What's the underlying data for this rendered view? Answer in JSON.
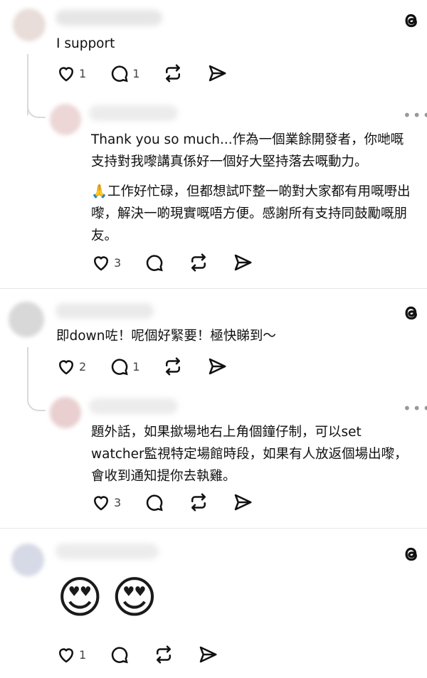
{
  "app": {
    "logo_icon": "threads-icon"
  },
  "comments": [
    {
      "text": "I support",
      "likes": "1",
      "replies": "1",
      "reply": {
        "paragraphs": [
          "Thank you so much...作為一個業餘開發者，你哋嘅支持對我嚟講真係好一個好大堅持落去嘅動力。",
          "🙏工作好忙碌，但都想試吓整一啲對大家都有用嘅嘢出嚟，解決一啲現實嘅唔方便。感謝所有支持同鼓勵嘅朋友。"
        ],
        "likes": "3"
      }
    },
    {
      "text": "即down咗！呢個好緊要！極快睇到～",
      "likes": "2",
      "replies": "1",
      "reply": {
        "paragraphs": [
          "題外話，如果撳場地右上角個鐘仔制，可以set watcher監視特定場館時段，如果有人放返個場出嚟，會收到通知提你去執雞。"
        ],
        "likes": "3"
      }
    },
    {
      "emojis": [
        "😍",
        "😍"
      ],
      "likes": "1"
    }
  ]
}
